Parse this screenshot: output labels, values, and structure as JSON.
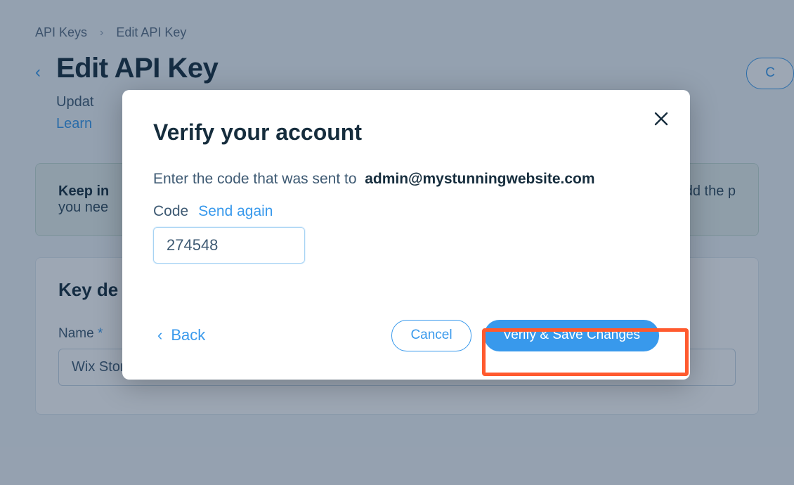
{
  "breadcrumb": {
    "root": "API Keys",
    "current": "Edit API Key"
  },
  "page": {
    "title": "Edit API Key",
    "subtitle_prefix": "Updat",
    "learn_prefix": "Learn",
    "copy_label": "C"
  },
  "banner": {
    "lead": "Keep in",
    "trail1": "y add the p",
    "trail2": "you nee"
  },
  "card": {
    "heading": "Key de",
    "name_label": "Name",
    "name_value": "Wix Stores key"
  },
  "modal": {
    "title": "Verify your account",
    "prompt_prefix": "Enter the code that was sent to",
    "email": "admin@mystunningwebsite.com",
    "code_label": "Code",
    "send_again": "Send again",
    "code_value": "274548",
    "back": "Back",
    "cancel": "Cancel",
    "verify": "Verify & Save Changes"
  }
}
